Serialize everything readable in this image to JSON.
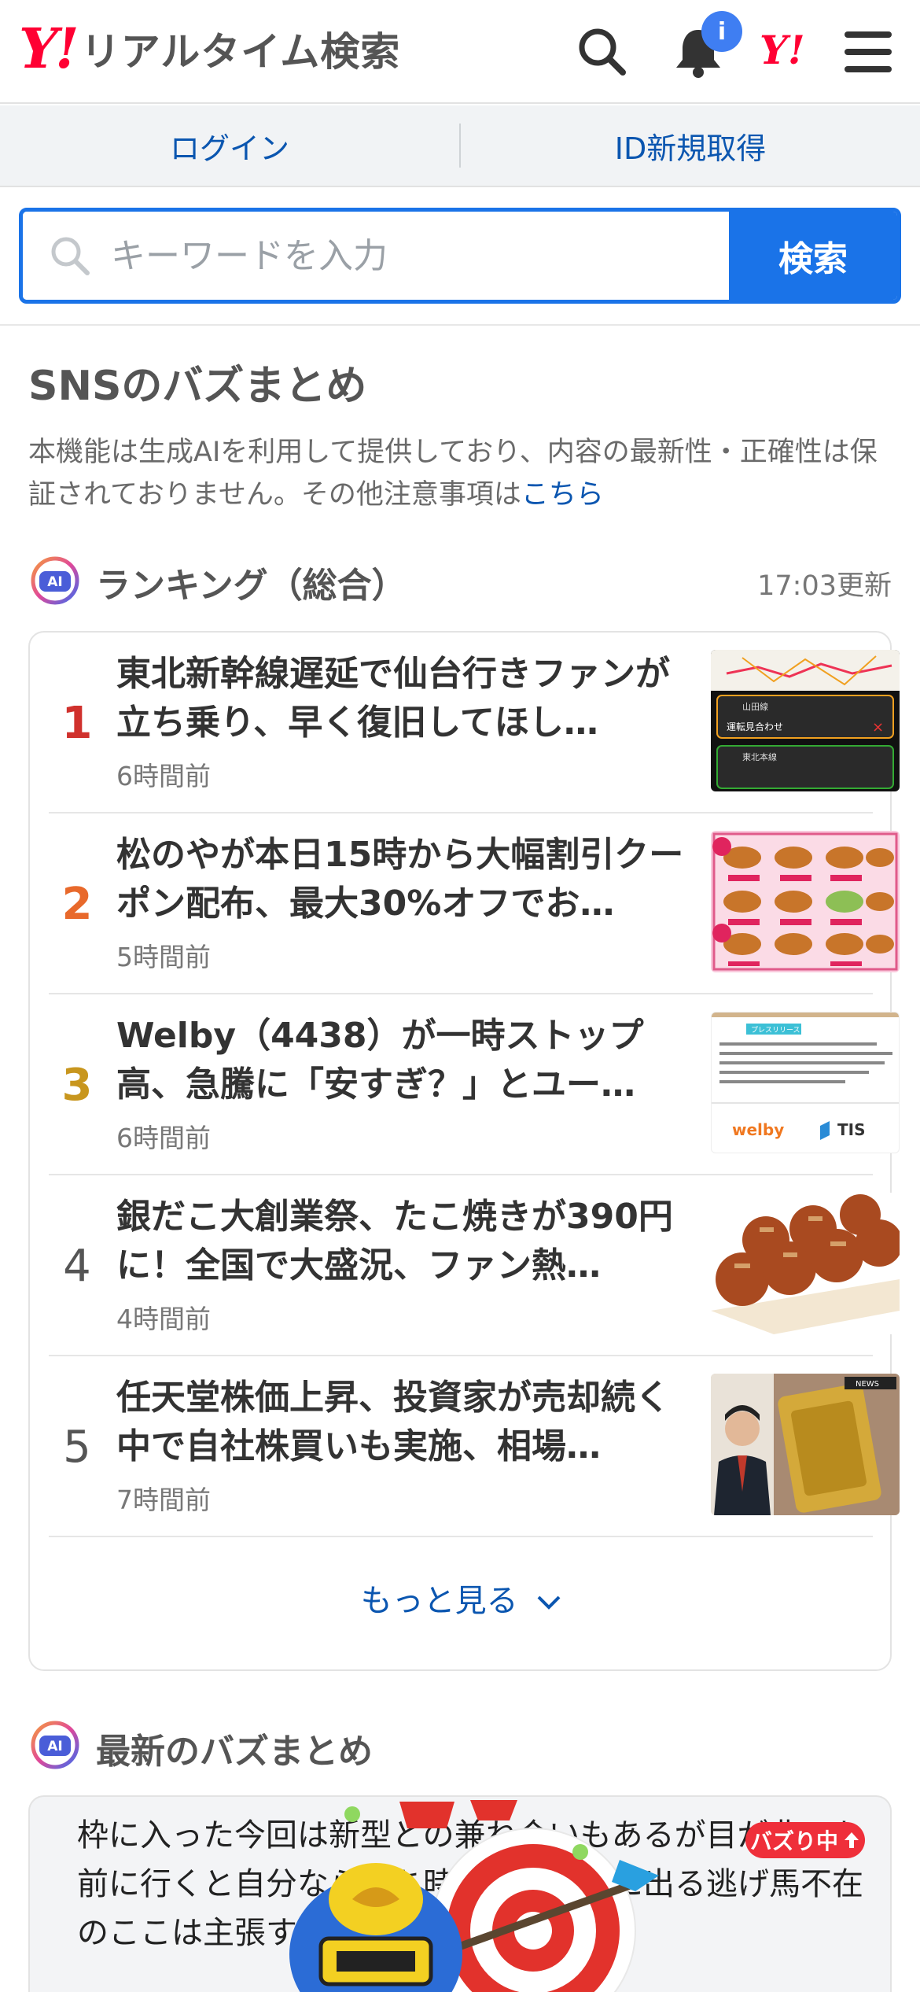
{
  "header": {
    "logo_mark": "Y!",
    "logo_text": "リアルタイム検索",
    "notification_count": "i",
    "yj_mark": "Y!"
  },
  "account": {
    "login": "ログイン",
    "signup": "ID新規取得"
  },
  "search": {
    "placeholder": "キーワードを入力",
    "button": "検索"
  },
  "sns": {
    "title": "SNSのバズまとめ",
    "notice": "本機能は生成AIを利用して提供しており、内容の最新性・正確性は保証されておりません。その他注意事項は",
    "notice_link": "こちら"
  },
  "ranking": {
    "ai_label": "AI",
    "heading": "ランキング（総合）",
    "updated": "17:03更新",
    "items": [
      {
        "rank": "1",
        "title": "東北新幹線遅延で仙台行きファンが立ち乗り、早く復旧してほし…",
        "time": "6時間前",
        "color": "#d0312d"
      },
      {
        "rank": "2",
        "title": "松のやが本日15時から大幅割引クーポン配布、最大30%オフでお…",
        "time": "5時間前",
        "color": "#e8692b"
      },
      {
        "rank": "3",
        "title": "Welby（4438）が一時ストップ高、急騰に「安すぎ？」とユー…",
        "time": "6時間前",
        "color": "#c8961e"
      },
      {
        "rank": "4",
        "title": "銀だこ大創業祭、たこ焼きが390円に！全国で大盛況、ファン熱…",
        "time": "4時間前",
        "color": "#555555"
      },
      {
        "rank": "5",
        "title": "任天堂株価上昇、投資家が売却続く中で自社株買いも実施、相場…",
        "time": "7時間前",
        "color": "#555555"
      }
    ],
    "more": "もっと見る"
  },
  "latest": {
    "ai_label": "AI",
    "heading": "最新のバズまとめ",
    "badge": "バズり中",
    "text": "枠に入った今回は新型との兼ね合いもあるが目が非でも前に行くと自分なら持ち時計分は確実に出る逃げ馬不在のここは主張するはず。"
  },
  "thumb_labels": {
    "t1_a": "山田線",
    "t1_b": "運転見合わせ",
    "t1_c": "東北本線",
    "t3_tag": "プレスリリース",
    "t3_brand1": "welby",
    "t3_brand2": "TIS",
    "t5_news": "NEWS"
  }
}
